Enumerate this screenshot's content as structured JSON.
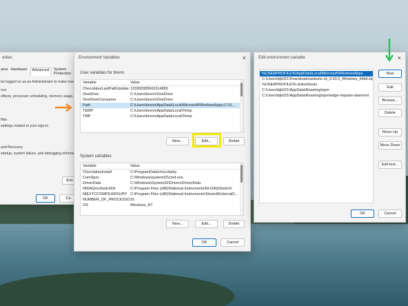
{
  "system_properties": {
    "title": "erties",
    "tabs": [
      "ame",
      "Hardware",
      "Advanced",
      "System Protection"
    ],
    "active_tab": "Advanced",
    "lines": [
      "be logged on as an Administrator to make most",
      "nce",
      "effects, processor scheduling, memory usage, and",
      "files",
      "settings related to your sign-in",
      "and Recovery",
      "startup, system failure, and debugging information"
    ],
    "env_button": "Env",
    "ok": "OK",
    "cancel": "Ca"
  },
  "env_vars": {
    "title": "Environment Variables",
    "user_section": "User variables for brenn",
    "col_variable": "Variable",
    "col_value": "Value",
    "user_rows": [
      {
        "name": "ChocolateyLastPathUpdate",
        "value": "133300995663114895"
      },
      {
        "name": "OneDrive",
        "value": "C:\\Users\\brenn\\OneDrive"
      },
      {
        "name": "OneDriveConsumer",
        "value": "C:\\Users\\brenn\\OneDrive"
      },
      {
        "name": "Path",
        "value": "C:\\Users\\brenn\\AppData\\Local\\Microsoft\\WindowsApps;C:\\U..."
      },
      {
        "name": "TEMP",
        "value": "C:\\Users\\brenn\\AppData\\Local\\Temp"
      },
      {
        "name": "TMP",
        "value": "C:\\Users\\brenn\\AppData\\Local\\Temp"
      }
    ],
    "selected_user_row": "Path",
    "user_new": "New...",
    "user_edit": "Edit...",
    "user_delete": "Delete",
    "system_section": "System variables",
    "system_rows": [
      {
        "name": "ChocolateyInstall",
        "value": "C:\\ProgramData\\chocolatey"
      },
      {
        "name": "ComSpec",
        "value": "C:\\Windows\\system32\\cmd.exe"
      },
      {
        "name": "DriverData",
        "value": "C:\\Windows\\System32\\Drivers\\DriverData"
      },
      {
        "name": "NIDAQmxSwitchDir",
        "value": "C:\\Program Files (x86)\\National Instruments\\NI-DAQ\\Switch\\"
      },
      {
        "name": "NIEXTCCOMPILERSUPP",
        "value": "C:\\Program Files (x86)\\National Instruments\\Shared\\ExternalC..."
      },
      {
        "name": "NUMBER_OF_PROCESSORS",
        "value": "16"
      },
      {
        "name": "OS",
        "value": "Windows_NT"
      }
    ],
    "system_new": "New...",
    "system_edit": "Edit...",
    "system_delete": "Delete",
    "ok": "OK",
    "cancel": "Cancel"
  },
  "edit_env": {
    "title": "Edit environment variable",
    "entries": [
      "%USERPROFILE%\\AppData\\Local\\Microsoft\\WindowsApps",
      "C:\\Users\\bjk021\\Downloads\\arduino-cli_0.33.0_Windows_64bit.zip",
      "%USERPROFILE%\\.dotnet\\tools",
      "C:\\Users\\bjk021\\AppData\\Roaming\\npm",
      "C:\\Users\\bjk021\\AppData\\Roaming\\npm\\edge-impulse-daemon\\"
    ],
    "buttons": {
      "new": "New",
      "edit": "Edit",
      "browse": "Browse...",
      "delete": "Delete",
      "move_up": "Move Up",
      "move_down": "Move Down",
      "edit_text": "Edit text..."
    },
    "ok": "OK",
    "cancel": "Cancel"
  },
  "annotations": {
    "green_arrow_color": "#2bbf5a",
    "orange_arrow_color": "#f08a24",
    "highlight_color": "#f2e800"
  }
}
